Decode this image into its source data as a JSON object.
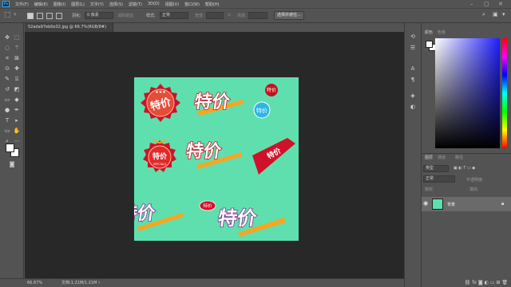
{
  "menubar": {
    "logo": "Ps",
    "items": [
      "文件(F)",
      "编辑(E)",
      "图像(I)",
      "图层(L)",
      "文字(Y)",
      "选择(S)",
      "滤镜(T)",
      "3D(D)",
      "视图(V)",
      "窗口(W)",
      "帮助(H)"
    ]
  },
  "options": {
    "feather_label": "羽化:",
    "feather_value": "0 像素",
    "antialias_label": "消除锯齿",
    "style_label": "样式:",
    "style_value": "正常",
    "width_label": "宽度:",
    "height_label": "高度:",
    "select_mask_button": "选择并遮住..."
  },
  "document": {
    "tab_title": "52ada97eb0e32.jpg @ 66.7%(RGB/8#)",
    "tab_close": "×"
  },
  "status": {
    "zoom": "66.67%",
    "doc_info": "文档:1.21M/1.21M"
  },
  "panels": {
    "color_tab": "颜色",
    "swatches_tab": "色板",
    "layers_tab": "图层",
    "channels_tab": "通道",
    "paths_tab": "路径",
    "filter_kind": "类型",
    "blend_mode": "正常",
    "opacity_label": "不透明度:",
    "lock_label": "锁定:",
    "fill_label": "填充:",
    "layer_name": "背景"
  },
  "artwork": {
    "badge_1_text": "特价",
    "badge_1_stars": "★★★",
    "title_large": "特价",
    "pill_1_text": "特价",
    "circle_1_text": "特价",
    "specials_text": "特价",
    "specials_sub": "SPECIALS",
    "title_2": "特价",
    "ribbon_text": "特价",
    "title_3": "特价",
    "pill_2_text": "特价",
    "title_4": "特价"
  },
  "colors": {
    "canvas_bg": "#5fdfae",
    "accent_red": "#d0112a",
    "accent_purple": "#7b2a8e",
    "accent_orange": "#f5a623"
  }
}
